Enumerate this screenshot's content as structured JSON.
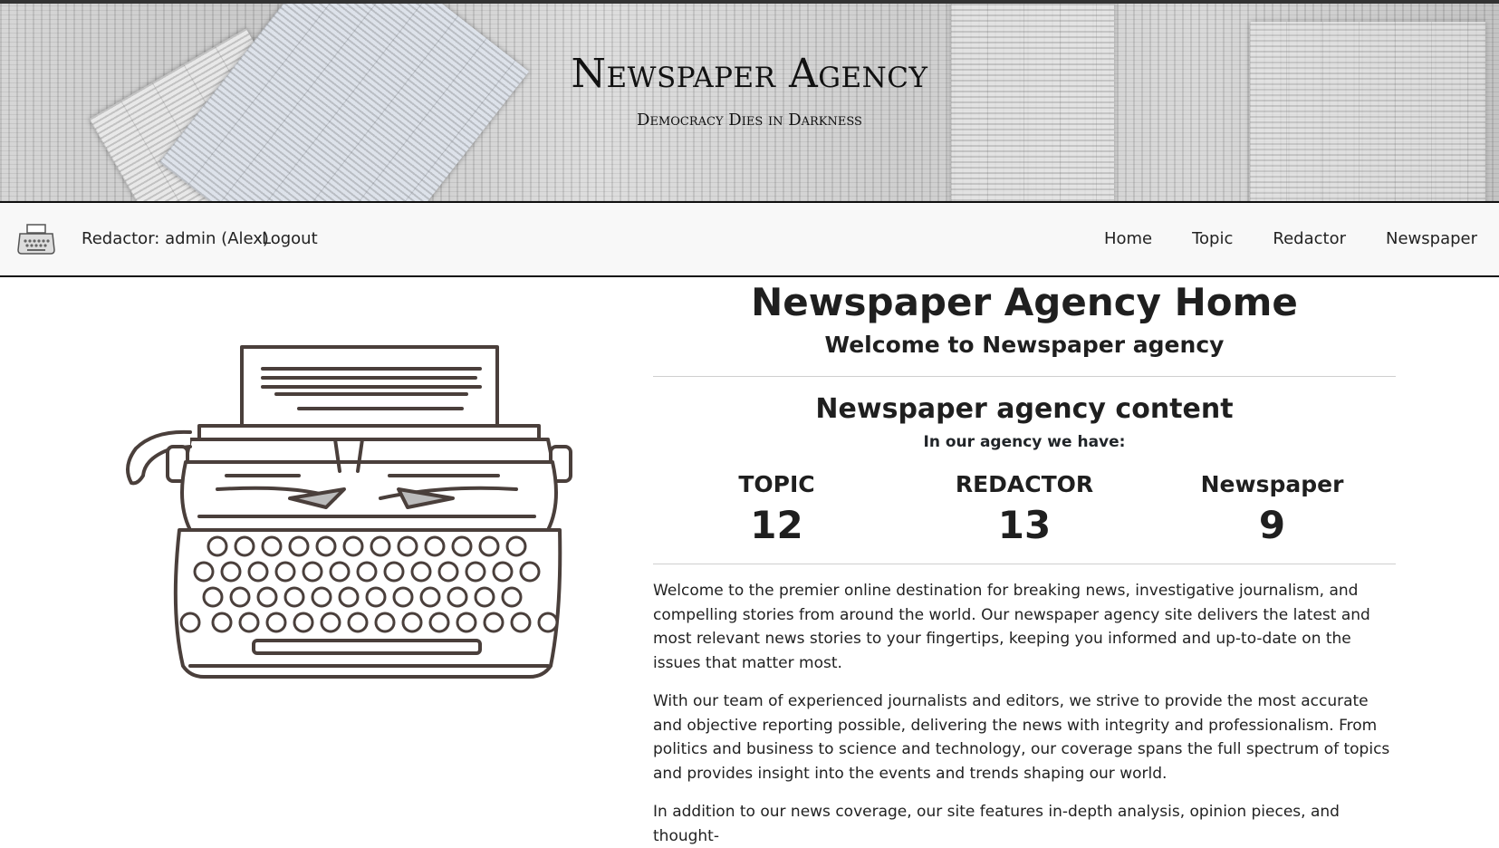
{
  "banner": {
    "title": "Newspaper Agency",
    "subtitle": "Democracy Dies in Darkness"
  },
  "nav": {
    "logo_icon": "typewriter-icon",
    "user_label": "Redactor: admin (Alex)",
    "logout_label": "Logout",
    "links": [
      "Home",
      "Topic",
      "Redactor",
      "Newspaper"
    ]
  },
  "main": {
    "title": "Newspaper Agency Home",
    "welcome": "Welcome to Newspaper agency",
    "content_title": "Newspaper agency content",
    "have_label": "In our agency we have:",
    "stats": [
      {
        "label": "TOPIC",
        "value": "12"
      },
      {
        "label": "REDACTOR",
        "value": "13"
      },
      {
        "label": "Newspaper",
        "value": "9"
      }
    ],
    "paragraphs": [
      "Welcome to the premier online destination for breaking news, investigative journalism, and compelling stories from around the world. Our newspaper agency site delivers the latest and most relevant news stories to your fingertips, keeping you informed and up-to-date on the issues that matter most.",
      "With our team of experienced journalists and editors, we strive to provide the most accurate and objective reporting possible, delivering the news with integrity and professionalism. From politics and business to science and technology, our coverage spans the full spectrum of topics and provides insight into the events and trends shaping our world.",
      "In addition to our news coverage, our site features in-depth analysis, opinion pieces, and thought-"
    ],
    "illustration_icon": "typewriter-illustration"
  }
}
